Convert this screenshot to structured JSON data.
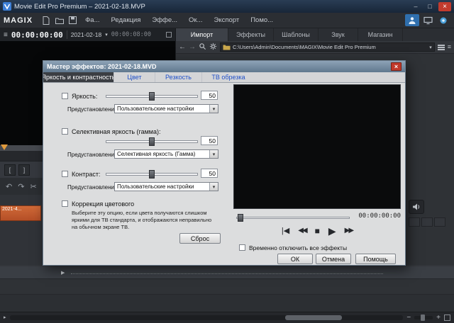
{
  "titlebar": {
    "app_title": "Movie Edit Pro Premium – 2021-02-18.MVP"
  },
  "brand": "MAGIX",
  "menubar": {
    "items": [
      "Фа...",
      "Редакция",
      "Эффе...",
      "Ок...",
      "Экспорт",
      "Помо..."
    ]
  },
  "transport": {
    "current_time": "00:00:00:00",
    "project_name": "2021-02-18",
    "duration": "00:00:08:00"
  },
  "panel_tabs": {
    "import": "Импорт",
    "effects": "Эффекты",
    "templates": "Шаблоны",
    "audio": "Звук",
    "store": "Магазин"
  },
  "browser": {
    "path": "C:\\Users\\Admin\\Documents\\MAGIX\\Movie Edit Pro Premium"
  },
  "timeline": {
    "clip_label": "2021-4..."
  },
  "icons": {
    "hamburger": "≡",
    "chevron_down": "▾",
    "back": "←",
    "forward": "→",
    "minimize": "–",
    "maximize": "□",
    "close": "×",
    "undo": "↶",
    "redo": "↷",
    "scissors": "✂",
    "collapse_arrow": "▶",
    "bracket_left": "[",
    "bracket_right": "]",
    "zoom_out": "−",
    "zoom_in": "+",
    "scroll_arrow": "▸"
  },
  "dialog": {
    "title": "Мастер эффектов: 2021-02-18.MVD",
    "tabs": {
      "brightness": "Яркость и контрастность",
      "color": "Цвет",
      "sharpness": "Резкость",
      "tv_crop": "ТВ обрезка"
    },
    "preset_label": "Предустановления",
    "sections": [
      {
        "label": "Яркость:",
        "value": "50",
        "preset": "Пользовательские настройки"
      },
      {
        "label": "Селективная яркость (гамма):",
        "value": "50",
        "preset": "Селективная яркость (Гамма)"
      },
      {
        "label": "Контраст:",
        "value": "50",
        "preset": "Пользовательские настройки"
      }
    ],
    "color_correction": {
      "label": "Коррекция цветового",
      "description": "Выберите эту опцию, если цвета получаются слишком яркими для ТВ стандарта, и отображаются неправильно на обычном экране ТВ."
    },
    "reset": "Сброс",
    "preview_time": "00:00:00:00",
    "transport_icons": {
      "skip_start": "|◀",
      "rewind": "◀◀",
      "stop": "■",
      "play": "▶",
      "forward": "▶▶"
    },
    "disable_effects": "Временно отключить все эффекты",
    "buttons": {
      "ok": "ОК",
      "cancel": "Отмена",
      "help": "Помощь"
    }
  }
}
